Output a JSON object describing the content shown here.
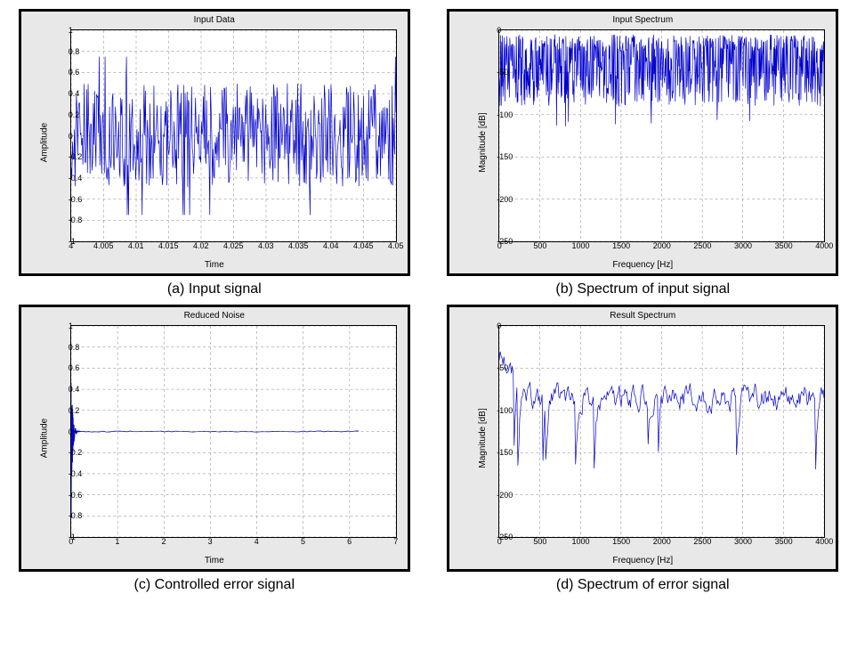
{
  "chart_data": [
    {
      "type": "line",
      "title": "Input Data",
      "xlabel": "Time",
      "ylabel": "Amplitude",
      "xlim": [
        4,
        4.05
      ],
      "ylim": [
        -1,
        1
      ],
      "xticks": [
        4,
        4.005,
        4.01,
        4.015,
        4.02,
        4.025,
        4.03,
        4.035,
        4.04,
        4.045,
        4.05
      ],
      "yticks": [
        -1,
        -0.8,
        -0.6,
        -0.4,
        -0.2,
        0,
        0.2,
        0.4,
        0.6,
        0.8,
        1
      ],
      "style": "dense-noise",
      "amp_center": 0,
      "amp_spread": 0.5,
      "outlier_amp": 0.75,
      "n_points": 500,
      "caption": "(a) Input signal"
    },
    {
      "type": "line",
      "title": "Input Spectrum",
      "xlabel": "Frequency [Hz]",
      "ylabel": "Magnitude [dB]",
      "xlim": [
        0,
        4000
      ],
      "ylim": [
        -250,
        0
      ],
      "xticks": [
        0,
        500,
        1000,
        1500,
        2000,
        2500,
        3000,
        3500,
        4000
      ],
      "yticks": [
        -250,
        -200,
        -150,
        -100,
        -50,
        0
      ],
      "style": "spectrum-dense",
      "mean_level": -30,
      "jitter_down": 60,
      "outlier_min": -115,
      "n_points": 800,
      "caption": "(b) Spectrum of input signal"
    },
    {
      "type": "line",
      "title": "Reduced Noise",
      "xlabel": "Time",
      "ylabel": "Amplitude",
      "xlim": [
        0,
        7
      ],
      "ylim": [
        -1,
        1
      ],
      "xticks": [
        0,
        1,
        2,
        3,
        4,
        5,
        6,
        7
      ],
      "yticks": [
        -1,
        -0.8,
        -0.6,
        -0.4,
        -0.2,
        0,
        0.2,
        0.4,
        0.6,
        0.8,
        1
      ],
      "style": "decaying-transient",
      "initial_amp": 0.9,
      "decay_end_x": 0.3,
      "flat_end_x": 6.2,
      "caption": "(c) Controlled error signal"
    },
    {
      "type": "line",
      "title": "Result Spectrum",
      "xlabel": "Frequency [Hz]",
      "ylabel": "Magnitude [dB]",
      "xlim": [
        0,
        4000
      ],
      "ylim": [
        -250,
        0
      ],
      "xticks": [
        0,
        500,
        1000,
        1500,
        2000,
        2500,
        3000,
        3500,
        4000
      ],
      "yticks": [
        -250,
        -200,
        -150,
        -100,
        -50,
        0
      ],
      "style": "spectrum-sparse",
      "start_level": -30,
      "mean_level": -85,
      "jitter": 22,
      "outlier_min": -170,
      "n_points": 350,
      "caption": "(d) Spectrum of error signal"
    }
  ]
}
